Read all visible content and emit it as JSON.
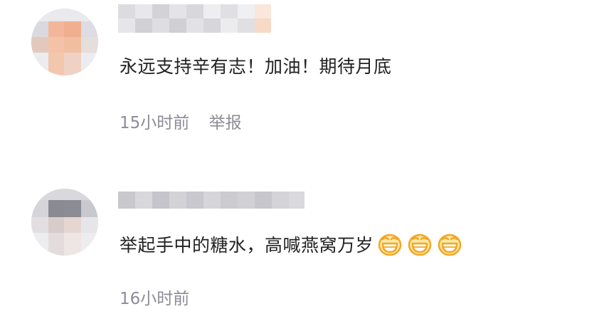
{
  "comments": [
    {
      "content": "永远支持辛有志！加油！期待月底",
      "time": "15小时前",
      "report_label": "举报"
    },
    {
      "content": "举起手中的糖水，高喊燕窝万岁",
      "emojis": [
        "grinning-face-icon",
        "grinning-face-icon",
        "grinning-face-icon"
      ],
      "time": "16小时前"
    }
  ],
  "colors": {
    "text": "#222222",
    "meta": "#8c8c96",
    "emoji": "#f5a623"
  }
}
